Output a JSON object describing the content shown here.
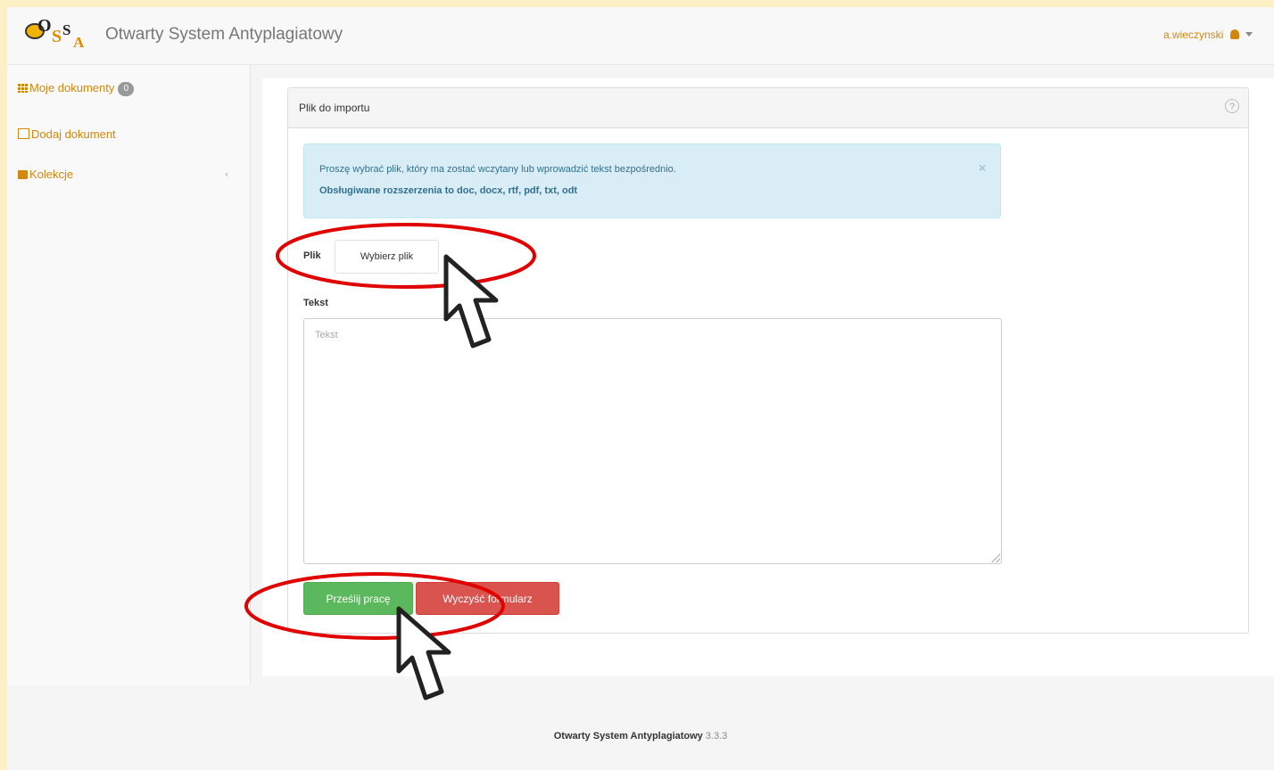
{
  "header": {
    "logo_text": [
      "O",
      "S",
      "S",
      "A"
    ],
    "brand": "Otwarty System Antyplagiatowy",
    "username": "a.wieczynski"
  },
  "sidebar": {
    "items": [
      {
        "label": "Moje dokumenty",
        "icon": "grid-icon",
        "badge": "0"
      },
      {
        "label": "Dodaj dokument",
        "icon": "document-icon"
      },
      {
        "label": "Kolekcje",
        "icon": "briefcase-icon"
      }
    ]
  },
  "panel": {
    "title": "Plik do importu",
    "alert_line1": "Proszę wybrać plik, który ma zostać wczytany lub wprowadzić tekst bezpośrednio.",
    "alert_line2": "Obsługiwane rozszerzenia to doc, docx, rtf, pdf, txt, odt",
    "file_label": "Plik",
    "file_button": "Wybierz plik",
    "text_label": "Tekst",
    "text_placeholder": "Tekst",
    "text_value": "",
    "submit_button": "Prześlij pracę",
    "clear_button": "Wyczyść formularz"
  },
  "footer": {
    "name": "Otwarty System Antyplagiatowy",
    "version": "3.3.3"
  },
  "colors": {
    "accent": "#d4870d",
    "highlight": "#e00000",
    "success": "#5cb85c",
    "danger": "#d9534f",
    "info_bg": "#d9edf7"
  }
}
